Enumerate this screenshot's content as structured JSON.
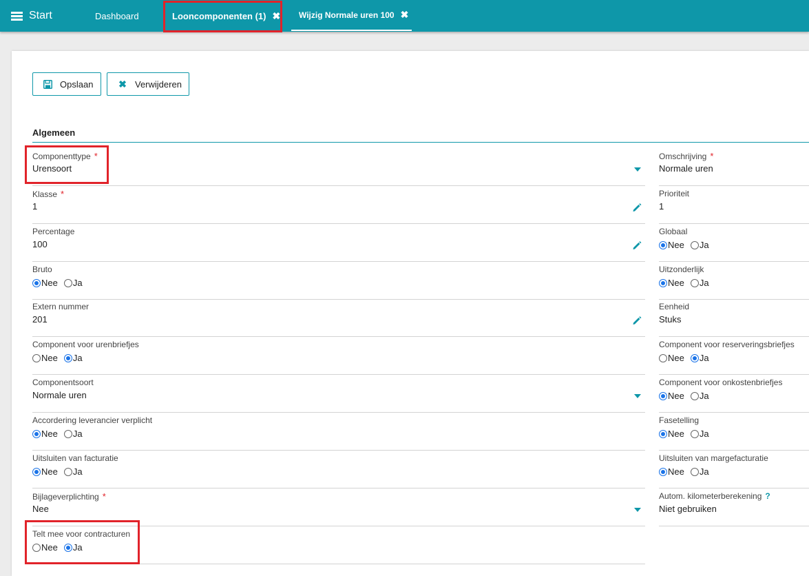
{
  "topbar": {
    "start_label": "Start",
    "tabs": [
      {
        "label": "Dashboard"
      },
      {
        "label": "Looncomponenten (1)"
      },
      {
        "label": "Wijzig Normale uren 100"
      }
    ]
  },
  "toolbar": {
    "save_label": "Opslaan",
    "delete_label": "Verwijderen"
  },
  "section": {
    "title": "Algemeen"
  },
  "left": {
    "componenttype": {
      "label": "Componenttype",
      "required": "*",
      "value": "Urensoort"
    },
    "klasse": {
      "label": "Klasse",
      "required": "*",
      "value": "1"
    },
    "percentage": {
      "label": "Percentage",
      "value": "100"
    },
    "bruto": {
      "label": "Bruto",
      "selected": "Nee"
    },
    "extern_nummer": {
      "label": "Extern nummer",
      "value": "201"
    },
    "urenbriefjes": {
      "label": "Component voor urenbriefjes",
      "selected": "Ja"
    },
    "componentsoort": {
      "label": "Componentsoort",
      "value": "Normale uren"
    },
    "accordering": {
      "label": "Accordering leverancier verplicht",
      "selected": "Nee"
    },
    "uitsluiten_facturatie": {
      "label": "Uitsluiten van facturatie",
      "selected": "Nee"
    },
    "bijlage": {
      "label": "Bijlageverplichting",
      "required": "*",
      "value": "Nee"
    },
    "contracturen": {
      "label": "Telt mee voor contracturen",
      "selected": "Ja"
    }
  },
  "right": {
    "omschrijving": {
      "label": "Omschrijving",
      "required": "*",
      "value": "Normale uren"
    },
    "prioriteit": {
      "label": "Prioriteit",
      "value": "1"
    },
    "globaal": {
      "label": "Globaal",
      "selected": "Nee"
    },
    "uitzonderlijk": {
      "label": "Uitzonderlijk",
      "selected": "Nee"
    },
    "eenheid": {
      "label": "Eenheid",
      "value": "Stuks"
    },
    "reserveringsbriefjes": {
      "label": "Component voor reserveringsbriefjes",
      "selected": "Ja"
    },
    "onkostenbriefjes": {
      "label": "Component voor onkostenbriefjes",
      "selected": "Nee"
    },
    "fasetelling": {
      "label": "Fasetelling",
      "selected": "Nee"
    },
    "margefacturatie": {
      "label": "Uitsluiten van margefacturatie",
      "selected": "Nee"
    },
    "kilometer": {
      "label": "Autom. kilometerberekening",
      "help": "?",
      "value": "Niet gebruiken"
    }
  },
  "radio_labels": {
    "nee": "Nee",
    "ja": "Ja"
  },
  "colors": {
    "accent": "#0e97a9",
    "highlight": "#e1232a",
    "radio": "#1a73e8"
  }
}
